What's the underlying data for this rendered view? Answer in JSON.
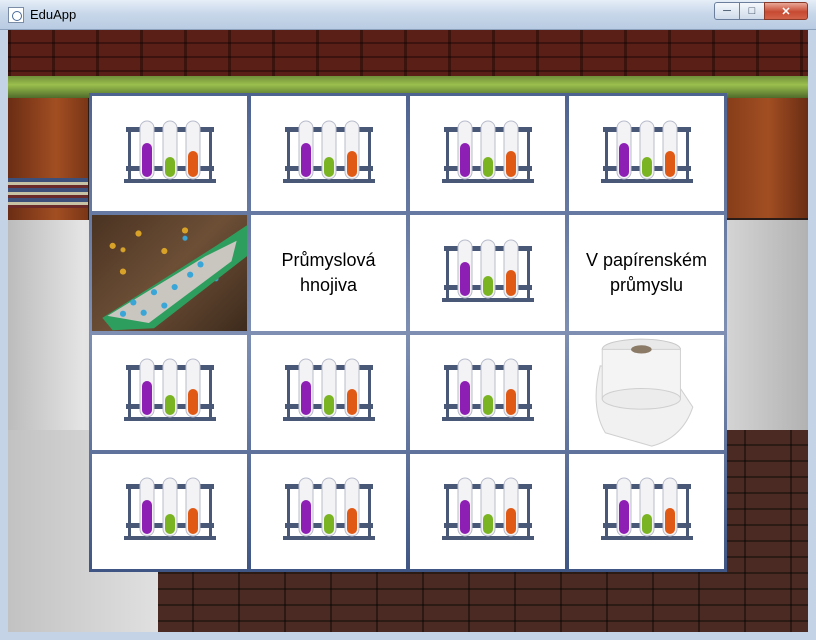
{
  "window": {
    "title": "EduApp",
    "buttons": {
      "minimize": "─",
      "maximize": "□",
      "close": "✕"
    }
  },
  "board": {
    "rows": 4,
    "cols": 4,
    "cards": [
      {
        "state": "hidden",
        "content": "test-tubes-rack-icon"
      },
      {
        "state": "hidden",
        "content": "test-tubes-rack-icon"
      },
      {
        "state": "hidden",
        "content": "test-tubes-rack-icon"
      },
      {
        "state": "hidden",
        "content": "test-tubes-rack-icon"
      },
      {
        "state": "revealed",
        "content": "fertilizer-scoop-image"
      },
      {
        "state": "revealed",
        "content": "text",
        "text": "Průmyslová hnojiva"
      },
      {
        "state": "hidden",
        "content": "test-tubes-rack-icon"
      },
      {
        "state": "revealed",
        "content": "text",
        "text": "V papírenském průmyslu"
      },
      {
        "state": "hidden",
        "content": "test-tubes-rack-icon"
      },
      {
        "state": "hidden",
        "content": "test-tubes-rack-icon"
      },
      {
        "state": "hidden",
        "content": "test-tubes-rack-icon"
      },
      {
        "state": "revealed",
        "content": "toilet-paper-roll-image"
      },
      {
        "state": "hidden",
        "content": "test-tubes-rack-icon"
      },
      {
        "state": "hidden",
        "content": "test-tubes-rack-icon"
      },
      {
        "state": "hidden",
        "content": "test-tubes-rack-icon"
      },
      {
        "state": "hidden",
        "content": "test-tubes-rack-icon"
      }
    ]
  },
  "colors": {
    "tube_liquid_1": "#8e1fb4",
    "tube_liquid_2": "#7ab422",
    "tube_liquid_3": "#e05a16",
    "rack": "#4a5878",
    "grid_frame": "#5a6e98"
  }
}
